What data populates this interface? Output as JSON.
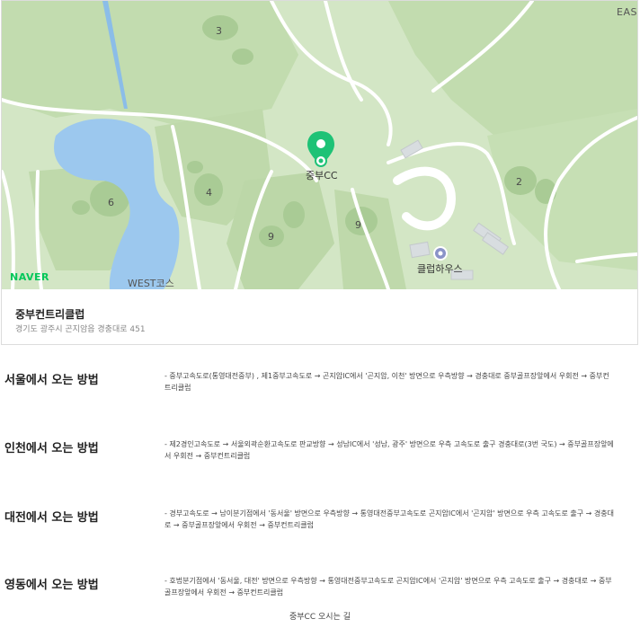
{
  "map": {
    "provider_logo": "NAVER",
    "compass_label": "EAST",
    "holes": [
      "3",
      "6",
      "4",
      "9",
      "9",
      "2"
    ],
    "course_label": "WEST코스",
    "pin_label": "중부CC",
    "clubhouse_label": "클럽하우스",
    "pin_color": "#1ec276",
    "water_color": "#9cc8ee",
    "grass_color": "#c2dcaf",
    "fairway_color": "#abcd99",
    "road_color": "#ffffff"
  },
  "place": {
    "name": "중부컨트리클럽",
    "address": "경기도 광주시 곤지암읍 경충대로 451"
  },
  "routes": [
    {
      "title": "서울에서 오는 방법",
      "description": "- 중부고속도로(통영대전중부) , 제1중부고속도로 → 곤지암IC에서 '곤지암, 이천' 방면으로 우측방향 → 경충대로 중부골프장앞에서 우회전 → 중부컨트리클럽"
    },
    {
      "title": "인천에서 오는 방법",
      "description": "- 제2경인고속도로 → 서울외곽순환고속도로 판교방향 → 성남IC에서 '성남, 광주' 방면으로 우측 고속도로 출구 경충대로(3번 국도) → 중부골프장앞에서 우회전 → 중부컨트리클럽"
    },
    {
      "title": "대전에서 오는 방법",
      "description": "- 경부고속도로 → 남이분기점에서 '동서울' 방면으로 우측방향 → 통영대전중부고속도로 곤지암IC에서 '곤지암' 방면으로 우측 고속도로 출구 → 경충대로 → 중부골프장앞에서 우회전 → 중부컨트리클럽"
    },
    {
      "title": "영동에서 오는 방법",
      "description": "- 호법분기점에서 '동서울, 대전' 방면으로 우측방향 → 통영대전중부고속도로 곤지암IC에서 '곤지암' 방면으로 우측 고속도로 출구 → 경충대로 → 중부골프장앞에서 우회전 → 중부컨트리클럽"
    }
  ],
  "footer": {
    "link_text": "중부CC 오시는 길"
  }
}
